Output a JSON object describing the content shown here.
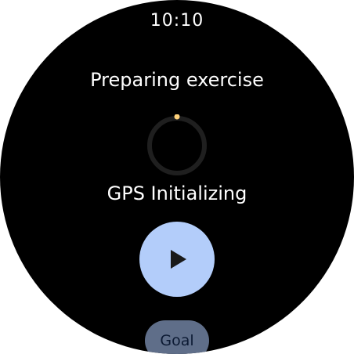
{
  "status_bar": {
    "time": "10:10"
  },
  "screen": {
    "title": "Preparing exercise",
    "status": "GPS Initializing",
    "progress": {
      "icon": "loading-ring-icon",
      "track_color": "#1f1f1f",
      "indicator_color": "#ffd27a"
    }
  },
  "actions": {
    "start": {
      "icon": "play-icon",
      "color": "#b3cdfa"
    },
    "goal": {
      "label": "Goal",
      "color": "#5f6e89"
    }
  }
}
